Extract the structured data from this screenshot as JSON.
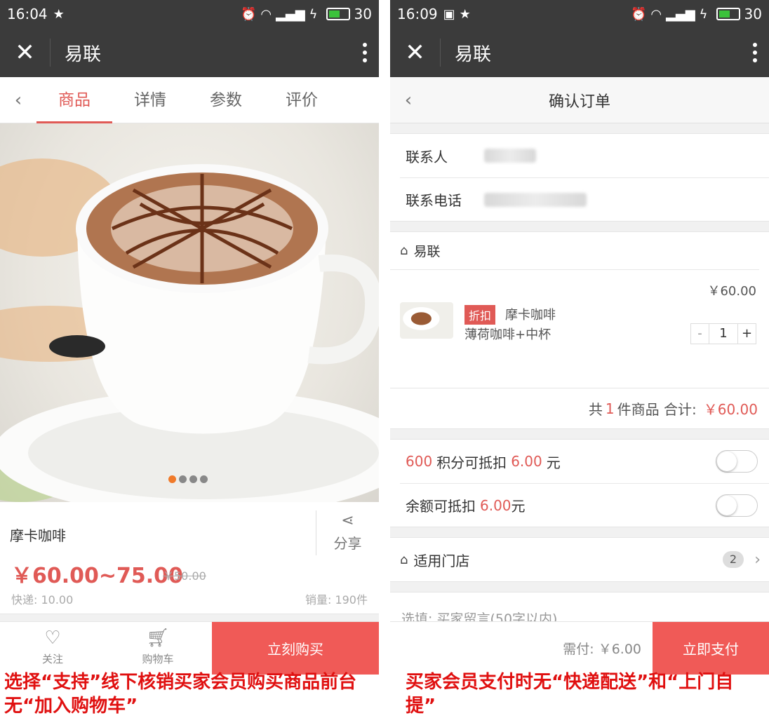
{
  "left": {
    "status": {
      "time": "16:04",
      "battery": "30"
    },
    "app_title": "易联",
    "tabs": [
      "商品",
      "详情",
      "参数",
      "评价"
    ],
    "product": {
      "name": "摩卡咖啡",
      "share_label": "分享",
      "price": "￥60.00~75.00",
      "old_price": "￥50.00",
      "shipping": "快递: 10.00",
      "sales": "销量: 190件"
    },
    "bottom": {
      "follow": "关注",
      "cart": "购物车",
      "buy_now": "立刻购买"
    },
    "caption": "选择“支持”线下核销买家会员购买商品前台无“加入购物车”"
  },
  "right": {
    "status": {
      "time": "16:09",
      "battery": "30"
    },
    "app_title": "易联",
    "page_title": "确认订单",
    "contact_label": "联系人",
    "phone_label": "联系电话",
    "shop_name": "易联",
    "item": {
      "price": "￥60.00",
      "tag": "折扣",
      "name": "摩卡咖啡",
      "spec": "薄荷咖啡+中杯",
      "qty": "1",
      "minus": "-",
      "plus": "+"
    },
    "total": {
      "prefix": "共",
      "count": "1",
      "mid": "件商品 合计:",
      "amount": "￥60.00"
    },
    "points": {
      "count": "600",
      "text1": "积分可抵扣",
      "amount": "6.00",
      "unit": "元"
    },
    "balance": {
      "text1": "余额可抵扣",
      "amount": "6.00",
      "unit": "元"
    },
    "stores": {
      "label": "适用门店",
      "count": "2"
    },
    "memo_placeholder": "选填: 买家留言(50字以内)",
    "pay": {
      "due": "需付: ￥6.00",
      "button": "立即支付"
    },
    "caption": "买家会员支付时无“快递配送”和“上门自提”"
  }
}
